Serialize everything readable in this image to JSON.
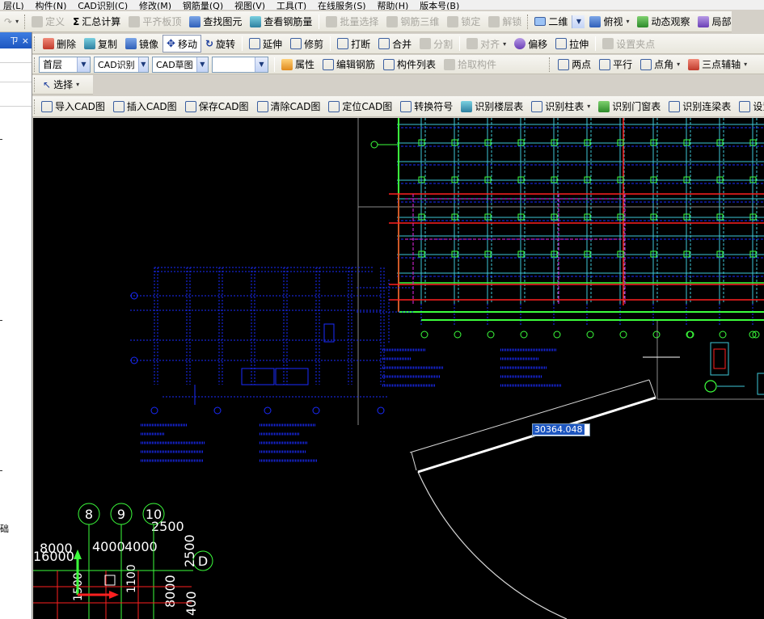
{
  "menu": [
    "层(L)",
    "构件(N)",
    "CAD识别(C)",
    "修改(M)",
    "钢筋量(Q)",
    "视图(V)",
    "工具(T)",
    "在线服务(S)",
    "帮助(H)",
    "版本号(B)"
  ],
  "toolbar1": {
    "define": "定义",
    "sum_calc": "汇总计算",
    "flush_slab": "平齐板顶",
    "find_element": "查找图元",
    "view_rebar": "查看钢筋量",
    "batch_select": "批量选择",
    "rebar_3d": "钢筋三维",
    "lock": "锁定",
    "unlock": "解锁",
    "view_mode": "二维",
    "top_view": "俯视",
    "dynamic_view": "动态观察",
    "local_3d": "局部三维"
  },
  "toolbar2": {
    "delete": "删除",
    "copy": "复制",
    "mirror": "镜像",
    "move": "移动",
    "rotate": "旋转",
    "extend": "延伸",
    "trim": "修剪",
    "break": "打断",
    "merge": "合并",
    "split": "分割",
    "align": "对齐",
    "offset": "偏移",
    "stretch": "拉伸",
    "set_grip": "设置夹点"
  },
  "toolbar3": {
    "floor": "首层",
    "cad_recognize": "CAD识别",
    "cad_draft": "CAD草图",
    "empty_combo": "",
    "properties": "属性",
    "edit_rebar": "编辑钢筋",
    "component_list": "构件列表",
    "pick_component": "拾取构件",
    "two_points": "两点",
    "parallel": "平行",
    "point_angle": "点角",
    "three_point_aux": "三点辅轴"
  },
  "toolbar4": {
    "select": "选择"
  },
  "toolbar5": {
    "import_cad": "导入CAD图",
    "insert_cad": "插入CAD图",
    "save_cad": "保存CAD图",
    "clear_cad": "清除CAD图",
    "locate_cad": "定位CAD图",
    "convert_symbol": "转换符号",
    "recognize_floor_table": "识别楼层表",
    "recognize_column_table": "识别柱表",
    "recognize_door_window_table": "识别门窗表",
    "recognize_beam_table": "识别连梁表",
    "set_scale": "设置比例"
  },
  "left_panel": {
    "pin": "ㄗ",
    "close": "×",
    "bottom_text": "础"
  },
  "canvas": {
    "dimension_value": "30364.048",
    "axis_labels": [
      "8",
      "9",
      "10"
    ],
    "axis_letter": "D",
    "dims": [
      "2500",
      "8000",
      "4000",
      "4000",
      "16000",
      "2500",
      "1500",
      "1100",
      "8000",
      "400"
    ]
  },
  "colors": {
    "canvas_bg": "#000000",
    "cad_blue": "#1a2bff",
    "cad_cyan": "#3ec8d8",
    "cad_green": "#3cff3c",
    "cad_red": "#ff2020",
    "cad_magenta": "#c020c0",
    "title_bar": "#1d56c0"
  }
}
